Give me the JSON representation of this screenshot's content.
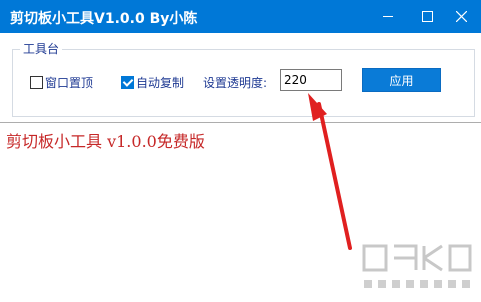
{
  "window": {
    "title": "剪切板小工具V1.0.0  By小陈"
  },
  "group": {
    "title": "工具台"
  },
  "options": {
    "always_on_top": {
      "label": "窗口置顶",
      "checked": false
    },
    "auto_copy": {
      "label": "自动复制",
      "checked": true
    }
  },
  "opacity": {
    "label": "设置透明度:",
    "value": "220"
  },
  "apply_button": {
    "label": "应用"
  },
  "clipboard": {
    "text": "剪切板小工具 v1.0.0免费版"
  },
  "colors": {
    "accent": "#0078d7",
    "text_red": "#c62828",
    "annotation_arrow": "#e02020"
  }
}
